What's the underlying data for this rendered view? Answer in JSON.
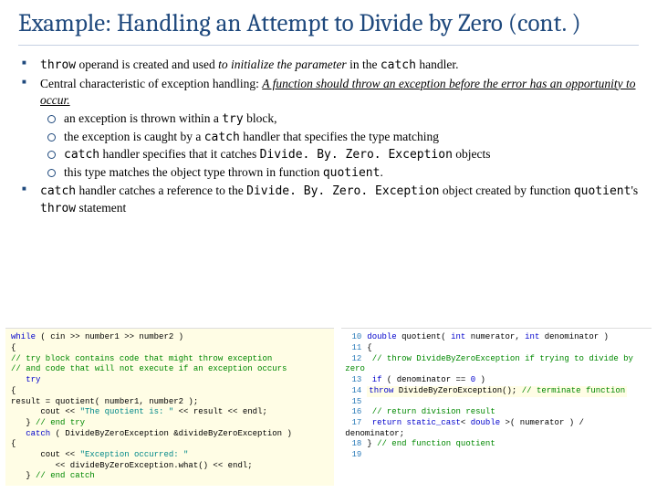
{
  "title": "Example: Handling an Attempt to Divide by Zero (cont. )",
  "bullets": {
    "b1a": "throw",
    "b1b": " operand is created and used ",
    "b1c": "to initialize the parameter",
    "b1d": " in the ",
    "b1e": "catch",
    "b1f": " handler.",
    "b2a": "Central characteristic of exception handling: ",
    "b2b": "A function should throw an exception before the error has an opportunity to occur.",
    "s1a": "an exception is thrown within a ",
    "s1b": "try",
    "s1c": " block,",
    "s2a": "the exception is caught by a ",
    "s2b": "catch",
    "s2c": " handler that specifies the type matching",
    "s3a": "catch",
    "s3b": " handler specifies that it catches ",
    "s3c": "Divide. By. Zero. Exception",
    "s3d": " objects",
    "s4a": "this type matches the object type thrown in function ",
    "s4b": "quotient",
    "s4c": ".",
    "b3a": "catch",
    "b3b": " handler catches a reference to the ",
    "b3c": "Divide. By. Zero. Exception",
    "b3d": " object created by function ",
    "b3e": "quotient",
    "b3f": "'s ",
    "b3g": "throw",
    "b3h": " statement"
  },
  "code_left": {
    "l1": "while ( cin >> number1 >> number2 )",
    "l2": "{",
    "l3": "   // try block contains code that might throw exception",
    "l4": "   // and code that will not execute if an exception occurs",
    "l5": "   try",
    "l6": "   {",
    "l7": "      result = quotient( number1, number2 );",
    "l8": "      cout << \"The quotient is: \" << result << endl;",
    "l9": "   } // end try",
    "l10": "   catch ( DivideByZeroException &divideByZeroException )",
    "l11": "   {",
    "l12": "      cout << \"Exception occurred: \"",
    "l13": "         << divideByZeroException.what() << endl;",
    "l14": "   } // end catch"
  },
  "code_right": {
    "r10a": "double",
    "r10b": " quotient( ",
    "r10c": "int",
    "r10d": " numerator, ",
    "r10e": "int",
    "r10f": " denominator )",
    "r11": "{",
    "r12": "   // throw DivideByZeroException if trying to divide by zero",
    "r13a": "   if",
    "r13b": " ( denominator == ",
    "r13c": "0",
    "r13d": " )",
    "r14a": "      throw",
    "r14b": " DivideByZeroException(); ",
    "r14c": "// terminate function",
    "r16": "   // return division result",
    "r17a": "   return static_cast",
    "r17b": "< ",
    "r17c": "double",
    "r17d": " >( numerator ) / denominator;",
    "r18": "} ",
    "r18b": "// end function quotient"
  },
  "linenums": {
    "n10": "10",
    "n11": "11",
    "n12": "12",
    "n13": "13",
    "n14": "14",
    "n15": "15",
    "n16": "16",
    "n17": "17",
    "n18": "18",
    "n19": "19"
  }
}
